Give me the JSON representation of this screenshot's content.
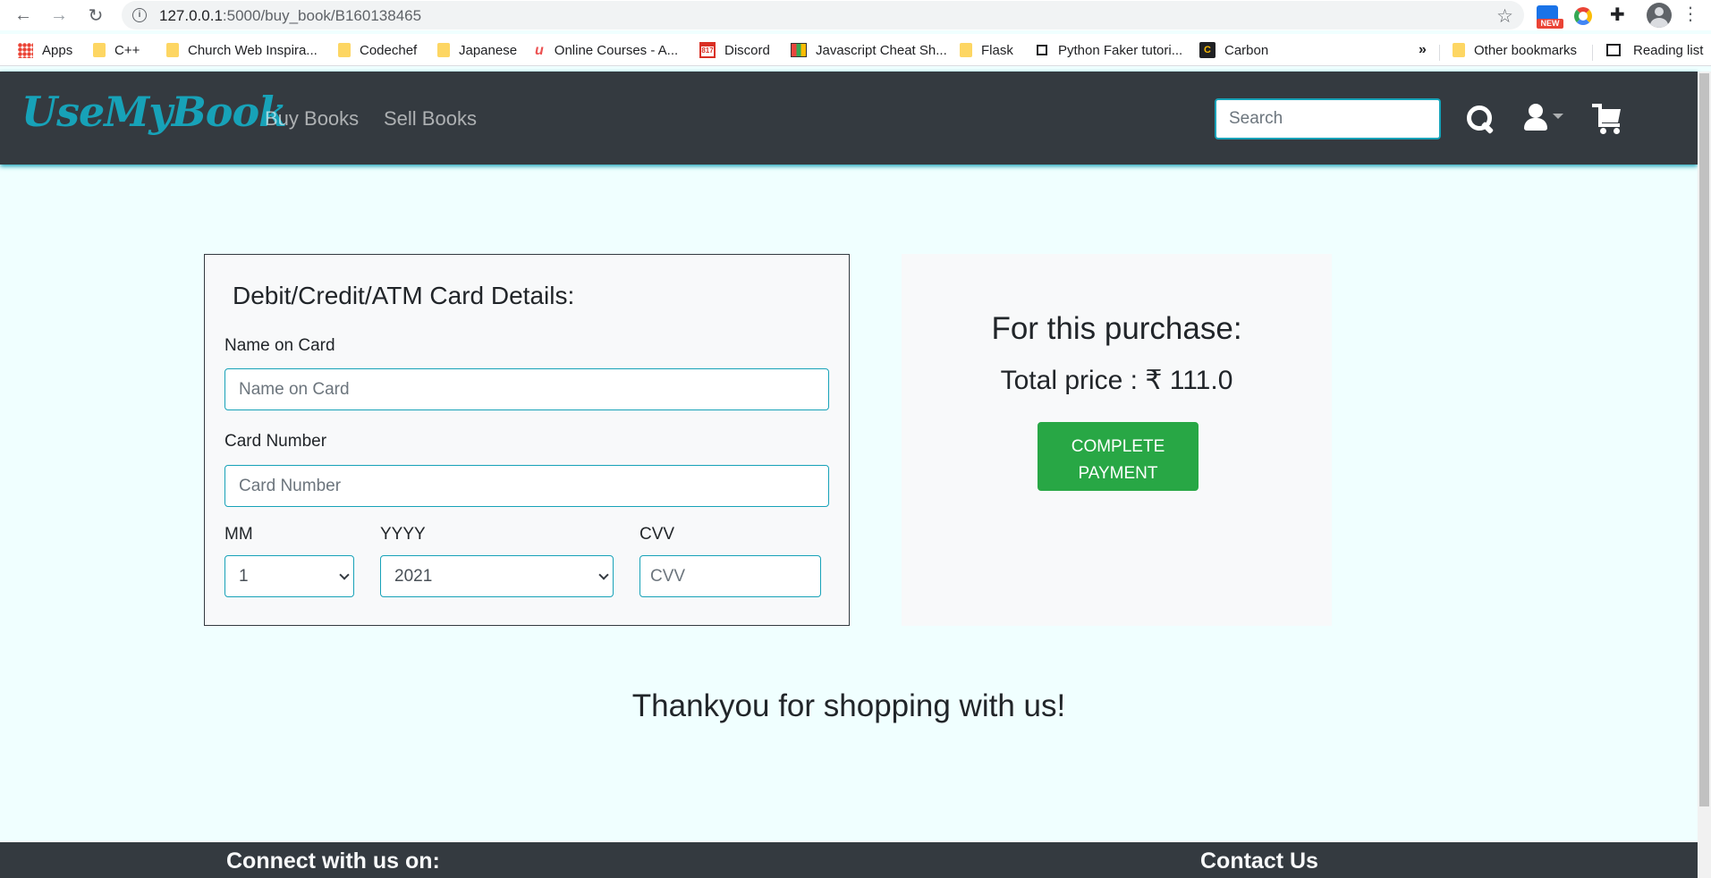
{
  "browser": {
    "url_host": "127.0.0.1",
    "url_rest": ":5000/buy_book/B160138465",
    "bookmarks": [
      "Apps",
      "C++",
      "Church Web Inspira...",
      "Codechef",
      "Japanese",
      "Online Courses - A...",
      "Discord",
      "Javascript Cheat Sh...",
      "Flask",
      "Python Faker tutori...",
      "Carbon"
    ],
    "overflow": "»",
    "other_bookmarks": "Other bookmarks",
    "reading_list": "Reading list",
    "ext_new_badge": "NEW",
    "discord_badge": "817"
  },
  "nav": {
    "brand": "UseMyBook",
    "links": [
      "Buy Books",
      "Sell Books"
    ],
    "search_placeholder": "Search"
  },
  "card_form": {
    "title": "Debit/Credit/ATM Card Details:",
    "name_label": "Name on Card",
    "name_placeholder": "Name on Card",
    "number_label": "Card Number",
    "number_placeholder": "Card Number",
    "mm_label": "MM",
    "mm_value": "1",
    "yyyy_label": "YYYY",
    "yyyy_value": "2021",
    "cvv_label": "CVV",
    "cvv_placeholder": "CVV"
  },
  "summary": {
    "title": "For this purchase:",
    "price_text": "Total price : ₹ 111.0",
    "pay_button": "COMPLETE PAYMENT"
  },
  "thanks": "Thankyou for shopping with us!",
  "footer": {
    "connect": "Connect with us on:",
    "contact": "Contact Us"
  },
  "colors": {
    "accent": "#17a2b8",
    "navbar": "#343a40",
    "page_bg": "#f0ffff",
    "success": "#28a745"
  }
}
